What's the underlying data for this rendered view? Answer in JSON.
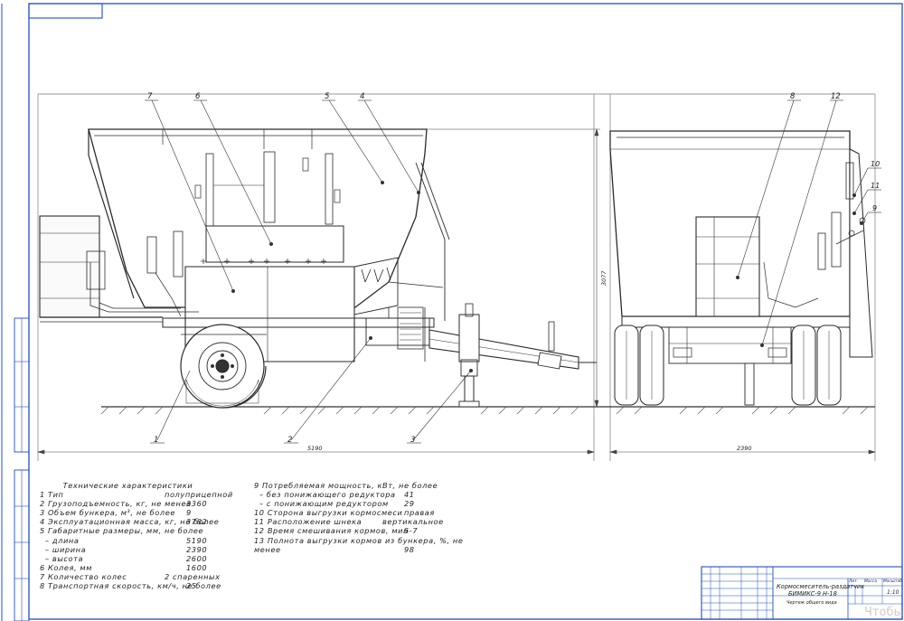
{
  "sheet_number": "",
  "callouts": {
    "c1": "1",
    "c2": "2",
    "c3": "3",
    "c4": "4",
    "c5": "5",
    "c6": "6",
    "c7": "7",
    "c8": "8",
    "c9": "9",
    "c10": "10",
    "c11": "11",
    "c12": "12"
  },
  "dimensions": {
    "height": "3077",
    "length": "5190",
    "width": "2390"
  },
  "specs": {
    "title": "Технические характеристики",
    "left": [
      {
        "label": "1 Тип",
        "value": "полуприцепной"
      },
      {
        "label": "2 Грузоподъемность, кг, не менее",
        "value": "3360"
      },
      {
        "label": "3 Объем бункера, м³, не более",
        "value": "9"
      },
      {
        "label": "4 Эксплуатационная масса, кг, не более",
        "value": "3782"
      },
      {
        "label": "5 Габаритные размеры, мм, не более",
        "value": ""
      },
      {
        "label": "– длина",
        "value": "5190"
      },
      {
        "label": "– ширина",
        "value": "2390"
      },
      {
        "label": "– высота",
        "value": "2600"
      },
      {
        "label": "6 Колея, мм",
        "value": "1600"
      },
      {
        "label": "7 Количество колес",
        "value": "2 спаренных"
      },
      {
        "label": "8 Транспортная скорость, км/ч, не более",
        "value": "25"
      }
    ],
    "right": [
      {
        "label": "9 Потребляемая мощность, кВт, не более",
        "value": ""
      },
      {
        "label": "– без понижающего редуктора",
        "value": "41"
      },
      {
        "label": "– с понижающим редуктором",
        "value": "29"
      },
      {
        "label": "10 Сторона выгрузки кормосмеси",
        "value": "правая"
      },
      {
        "label": "11 Расположение  шнека",
        "value": "вертикальное"
      },
      {
        "label": "12 Время смешивания кормов, мин",
        "value": "5-7"
      },
      {
        "label": "13 Полнота выгрузки кормов из бункера, %, не",
        "value": ""
      },
      {
        "label": "менее",
        "value": "98"
      }
    ]
  },
  "title_block": {
    "name_line1": "Кормосмеситель-раздатчик",
    "name_line2": "БИМИКС-9 Н-18",
    "name_line3": "Чертеж общего вида",
    "sheet_label": "Лит.",
    "mass_label": "Масса",
    "scale_label": "Масштаб",
    "scale_value": "1:10"
  },
  "watermark": "Чтобы"
}
